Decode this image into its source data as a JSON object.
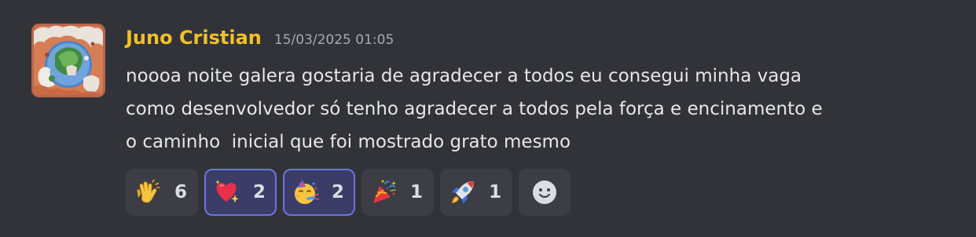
{
  "message": {
    "author": "Juno Cristian",
    "timestamp": "15/03/2025 01:05",
    "lines": [
      "noooa noite galera gostaria de agradecer a todos eu consegui minha vaga",
      "como desenvolvedor só tenho agradecer a todos pela força e encinamento e",
      "o caminho  inicial que foi mostrado grato mesmo"
    ],
    "author_color": "#f2c027",
    "avatar_icon": "illustrated-landscape-avatar-icon"
  },
  "reactions": [
    {
      "emoji": "clapping-hands-icon",
      "count": "6",
      "selected": false
    },
    {
      "emoji": "sparkling-heart-icon",
      "count": "2",
      "selected": true
    },
    {
      "emoji": "partying-face-icon",
      "count": "2",
      "selected": true
    },
    {
      "emoji": "party-popper-icon",
      "count": "1",
      "selected": false
    },
    {
      "emoji": "rocket-icon",
      "count": "1",
      "selected": false
    }
  ],
  "add_reaction": {
    "icon": "smiley-add-reaction-icon"
  },
  "colors": {
    "background": "#323339",
    "reaction_bg": "#3c3d45",
    "selected_reaction_bg": "#3b3d68",
    "selected_reaction_border": "#6d74e0"
  }
}
